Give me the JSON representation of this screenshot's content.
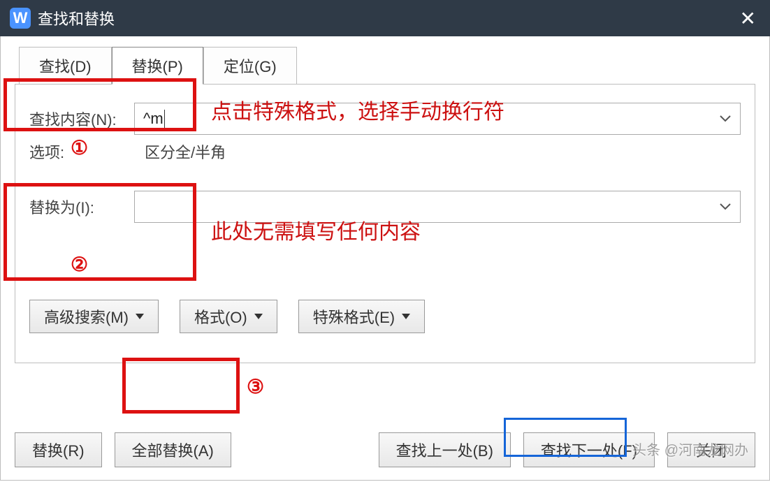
{
  "title": "查找和替换",
  "tabs": {
    "find": "查找(D)",
    "replace": "替换(P)",
    "goto": "定位(G)"
  },
  "labels": {
    "findWhat": "查找内容(N):",
    "replaceWith": "替换为(I):",
    "options": "选项:",
    "optionsValue": "区分全/半角"
  },
  "values": {
    "findWhat": "^m",
    "replaceWith": ""
  },
  "buttons": {
    "advanced": "高级搜索(M)",
    "format": "格式(O)",
    "special": "特殊格式(E)",
    "replace": "替换(R)",
    "replaceAll": "全部替换(A)",
    "findPrev": "查找上一处(B)",
    "findNext": "查找下一处(F)",
    "close": "关闭"
  },
  "annotations": {
    "a1": "点击特殊格式，选择手动换行符",
    "a2": "此处无需填写任何内容",
    "n1": "①",
    "n2": "②",
    "n3": "③"
  },
  "watermark": "头条 @河南龙网办"
}
